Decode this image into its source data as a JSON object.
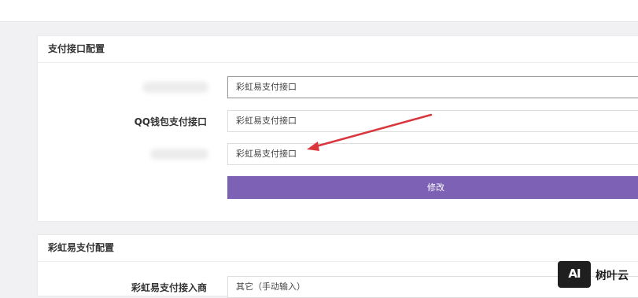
{
  "panel1": {
    "title": "支付接口配置",
    "rows": [
      {
        "label": "",
        "value": "彩虹易支付接口"
      },
      {
        "label": "QQ钱包支付接口",
        "value": "彩虹易支付接口"
      },
      {
        "label": "",
        "value": "彩虹易支付接口"
      }
    ],
    "submit_label": "修改"
  },
  "panel2": {
    "title": "彩虹易支付配置",
    "provider_label": "彩虹易支付接入商",
    "provider_value": "其它（手动输入）"
  },
  "watermark": {
    "badge": "AI",
    "text": "树叶云"
  },
  "colors": {
    "accent": "#7c61b5",
    "arrow": "#d9363e"
  }
}
